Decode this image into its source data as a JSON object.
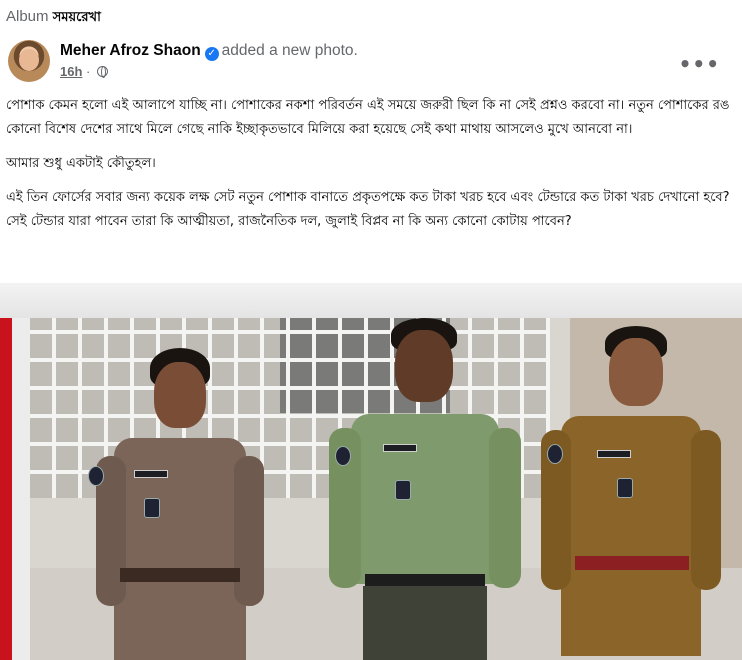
{
  "album": {
    "prefix": "Album",
    "name": "সময়রেখা"
  },
  "post": {
    "author": "Meher Afroz Shaon",
    "action": "added a new photo.",
    "time": "16h",
    "verified_icon": "verified-check-icon",
    "privacy_icon": "globe-icon",
    "more_label": "•••",
    "paragraphs": [
      "পোশাক কেমন হলো এই আলাপে যাচ্ছি না। পোশাকের নকশা পরিবর্তন এই সময়ে জরুরী ছিল কি না সেই প্রশ্নও করবো না। নতুন পোশাকের রঙ কোনো বিশেষ দেশের সাথে মিলে গেছে নাকি ইচ্ছাকৃতভাবে মিলিয়ে করা হয়েছে সেই কথা মাথায় আসলেও মুখে আনবো না।",
      "আমার শুধু একটাই কৌতুহল।",
      "এই তিন ফোর্সের সবার জন্য কয়েক লক্ষ সেট নতুন পোশাক বানাতে প্রকৃতপক্ষে কত টাকা খরচ হবে এবং টেন্ডারে কত টাকা খরচ দেখানো হবে? সেই টেন্ডার যারা পাবেন তারা কি আত্মীয়তা, রাজনৈতিক দল, জুলাই বিপ্লব না কি অন্য কোনো কোটায় পাবেন?"
    ]
  },
  "colors": {
    "uniform_left": "#7b6559",
    "uniform_center": "#7f9a6d",
    "uniform_right": "#8a6428",
    "accent_red": "#c8121c",
    "link_grey": "#65676b",
    "verified_blue": "#1877f2"
  }
}
